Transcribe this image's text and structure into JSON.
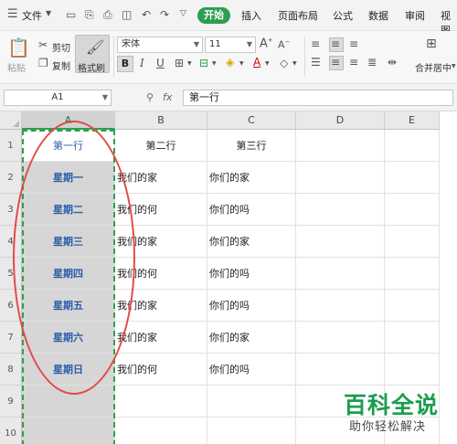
{
  "menubar": {
    "menu_icon": "hamburger-icon",
    "file_label": "文件",
    "tabs": [
      "开始",
      "插入",
      "页面布局",
      "公式",
      "数据",
      "审阅",
      "视图"
    ],
    "quick_access_icons": [
      "save-icon",
      "export-icon",
      "print-icon",
      "print-preview-icon",
      "undo-icon",
      "redo-icon",
      "more-icon"
    ]
  },
  "ribbon": {
    "paste_label": "粘贴",
    "cut_label": "剪切",
    "copy_label": "复制",
    "format_painter_label": "格式刷",
    "font_name": "宋体",
    "font_size": "11",
    "merge_center_label": "合并居中",
    "accent_color": "#2e9e4f"
  },
  "formula_bar": {
    "cell_ref": "A1",
    "fx_label": "fx",
    "content": "第一行"
  },
  "sheet": {
    "columns": [
      "A",
      "B",
      "C",
      "D",
      "E"
    ],
    "rows": [
      "1",
      "2",
      "3",
      "4",
      "5",
      "6",
      "7",
      "8",
      "9",
      "10"
    ],
    "colA": [
      "第一行",
      "星期一",
      "星期二",
      "星期三",
      "星期四",
      "星期五",
      "星期六",
      "星期日",
      "",
      ""
    ],
    "colB": [
      "第二行",
      "我们的家",
      "我们的何",
      "我们的家",
      "我们的何",
      "我们的家",
      "我们的家",
      "我们的何",
      "",
      ""
    ],
    "colC": [
      "第三行",
      "你们的家",
      "你们的吗",
      "你们的家",
      "你们的吗",
      "你们的吗",
      "你们的家",
      "你们的吗",
      "",
      ""
    ]
  },
  "watermark": {
    "title": "百科全说",
    "subtitle": "助你轻松解决"
  }
}
